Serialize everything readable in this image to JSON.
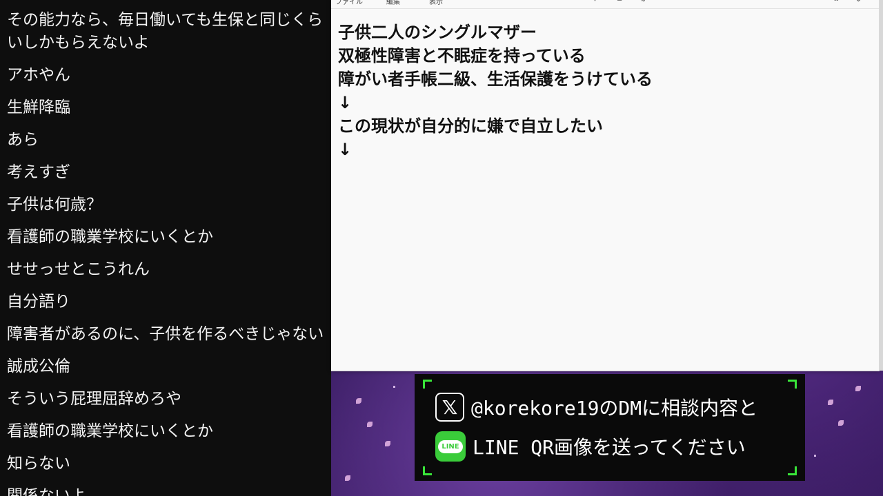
{
  "chat": {
    "messages": [
      "その能力なら、毎日働いても生保と同じくらいしかもらえないよ",
      "アホやん",
      "生鮮降臨",
      "あら",
      "考えすぎ",
      "子供は何歳？",
      "看護師の職業学校にいくとか",
      "せせっせとこうれん",
      "自分語り",
      "障害者があるのに、子供を作るべきじゃない",
      "誠成公倫",
      "そういう屁理屈辞めろや",
      "看護師の職業学校にいくとか",
      "知らない",
      "関係ないよ"
    ]
  },
  "notepad": {
    "menu": [
      "ファイル",
      "編集",
      "表示"
    ],
    "lines": [
      "子供二人のシングルマザー",
      "双極性障害と不眠症を持っている",
      "障がい者手帳二級、生活保護をうけている",
      "↓",
      "この現状が自分的に嫌で自立したい",
      "↓"
    ]
  },
  "banner": {
    "x_icon": "x-logo-icon",
    "line1": "@korekore19のDMに相談内容と",
    "line_icon_label": "LINE",
    "line2": "LINE QR画像を送ってください",
    "accent": "#39e639"
  }
}
